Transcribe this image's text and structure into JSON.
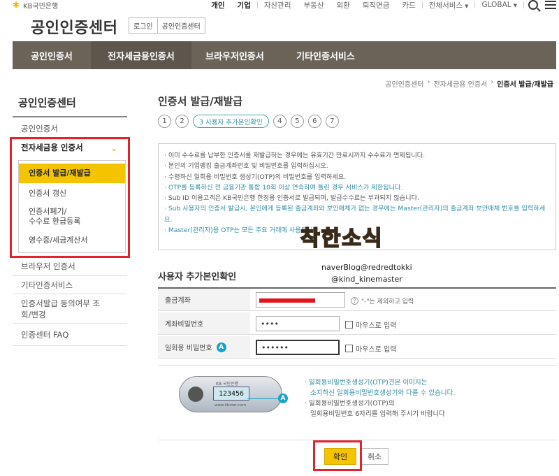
{
  "header": {
    "bank_logo": "KB국민은행",
    "center_title": "공인인증센터",
    "title_buttons": [
      "로그인",
      "공인인증센터"
    ],
    "util": {
      "personal": "개인",
      "business": "기업",
      "asset": "자산관리",
      "realestate": "부동산",
      "fx": "외환",
      "pension": "퇴직연금",
      "card": "카드",
      "all_services": "전체서비스",
      "global": "GLOBAL"
    }
  },
  "gnb": [
    "공인인증서",
    "전자세금용인증서",
    "브라우저인증서",
    "기타인증서비스"
  ],
  "breadcrumb": [
    "공인인증센터",
    "전자세금용 인증서",
    "인증서 발급/재발급"
  ],
  "sidebar": {
    "title": "공인인증센터",
    "items": [
      "공인인증서",
      "전자세금용 인증서",
      "브라우저 인증서",
      "기타인증서비스",
      "인증서발급 동의여부 조회/변경",
      "인증센터 FAQ"
    ],
    "sub_items": [
      "인증서 발급/재발급",
      "인증서 갱신",
      "인증서폐기/\n수수료 환급등록",
      "영수증/세금계산서"
    ]
  },
  "main": {
    "title": "인증서 발급/재발급",
    "steps": [
      "1",
      "2",
      "3 사용자 추가본인확인",
      "4",
      "5",
      "6",
      "7"
    ],
    "notices": [
      "이미 수수료를 납부한 인증서를 재발급하는 경우에는 유효기간 만료시까지 수수료가 면제됩니다.",
      "본인의 기업뱅킹 출금계좌번호 및 비밀번호를 입력하십시오.",
      "수령하신 일회용 비밀번호 생성기(OTP)의 비밀번호를 입력하세요.",
      "OTP를 등록하신 전 금융기관 통합 10회 이상 연속하여 틀린 경우 서비스가 제한됩니다.",
      "Sub ID 이용고객은 KB국민은행 한정용 인증서로 발급되며, 발급수수료는 부과되지 않습니다.",
      "Sub 사용자의 인증서 발급시, 본인에게 등록된 출금계좌와 보안매체가 없는 경우에는 Master(관리자)의 출금계좌 보안매체 번호를 입력하세요.",
      "Master(관리자)용 OTP는 모든 주요 거래에 사용됩니다."
    ],
    "watermark": "착한소식",
    "watermark_lines": [
      "naverBlog@redredtokki",
      "@kind_kinemaster"
    ],
    "section_title": "사용자 추가본인확인",
    "form": {
      "account_label": "출금계좌",
      "account_hint": "\"-\"는 제외하고 입력",
      "password_label": "계좌비밀번호",
      "password_value": "••••",
      "otp_label": "일회용 비밀번호",
      "otp_badge": "A",
      "otp_value": "••••••",
      "mouse_input": "마우스로 입력"
    },
    "otp_info": {
      "device_brand": "KB 국민은행",
      "device_number": "123456",
      "device_footer": "www.kbstar.com",
      "badge": "A",
      "lines": [
        "일회용비밀번호생성기(OTP)견본 이미지는",
        "소지하신 일회용비밀번호생성기와 다를 수 있습니다.",
        "일회용비밀번호생성기(OTP)의",
        "일회용비밀번호 6자리를 입력해 주시기 바랍니다"
      ]
    },
    "buttons": {
      "confirm": "확인",
      "cancel": "취소"
    }
  },
  "colors": {
    "gnb": "#6b6358",
    "accent": "#f5c400",
    "highlight_red": "#e5212b",
    "link_blue": "#2f8ba6"
  }
}
